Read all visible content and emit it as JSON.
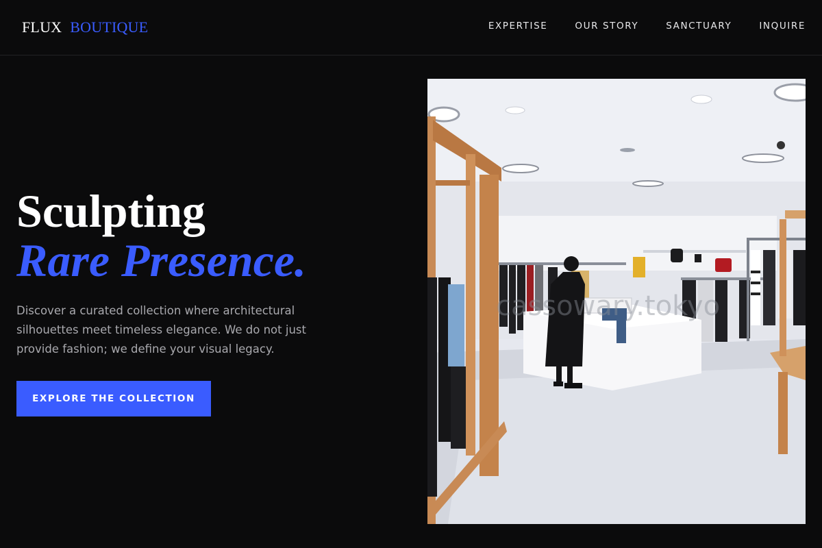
{
  "header": {
    "logo": {
      "primary": "FLUX",
      "secondary": "BOUTIQUE"
    },
    "nav": [
      {
        "label": "EXPERTISE"
      },
      {
        "label": "OUR STORY"
      },
      {
        "label": "SANCTUARY"
      },
      {
        "label": "INQUIRE"
      }
    ]
  },
  "hero": {
    "title_line1": "Sculpting",
    "title_line2": "Rare Presence.",
    "description": "Discover a curated collection where architectural silhouettes meet timeless elegance. We do not just provide fashion; we define your visual legacy.",
    "cta_label": "EXPLORE THE COLLECTION",
    "photo_watermark": "cassowary.tokyo"
  },
  "colors": {
    "background": "#0b0b0c",
    "accent": "#3a5cff",
    "text_primary": "#ffffff",
    "text_muted": "#a9a9ae"
  }
}
